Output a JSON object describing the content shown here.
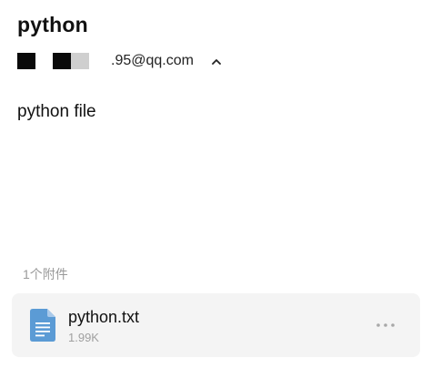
{
  "email": {
    "subject": "python",
    "sender_email": ".95@qq.com",
    "body": "python file"
  },
  "attachments": {
    "count_label": "1个附件",
    "items": [
      {
        "name": "python.txt",
        "size": "1.99K"
      }
    ]
  },
  "icons": {
    "expand": "chevron-up-icon",
    "file": "text-file-icon",
    "more": "more-dots-icon"
  },
  "colors": {
    "file_icon": "#5b9bd5",
    "card_background": "#f4f4f4",
    "muted_text": "#9a9a9a"
  }
}
